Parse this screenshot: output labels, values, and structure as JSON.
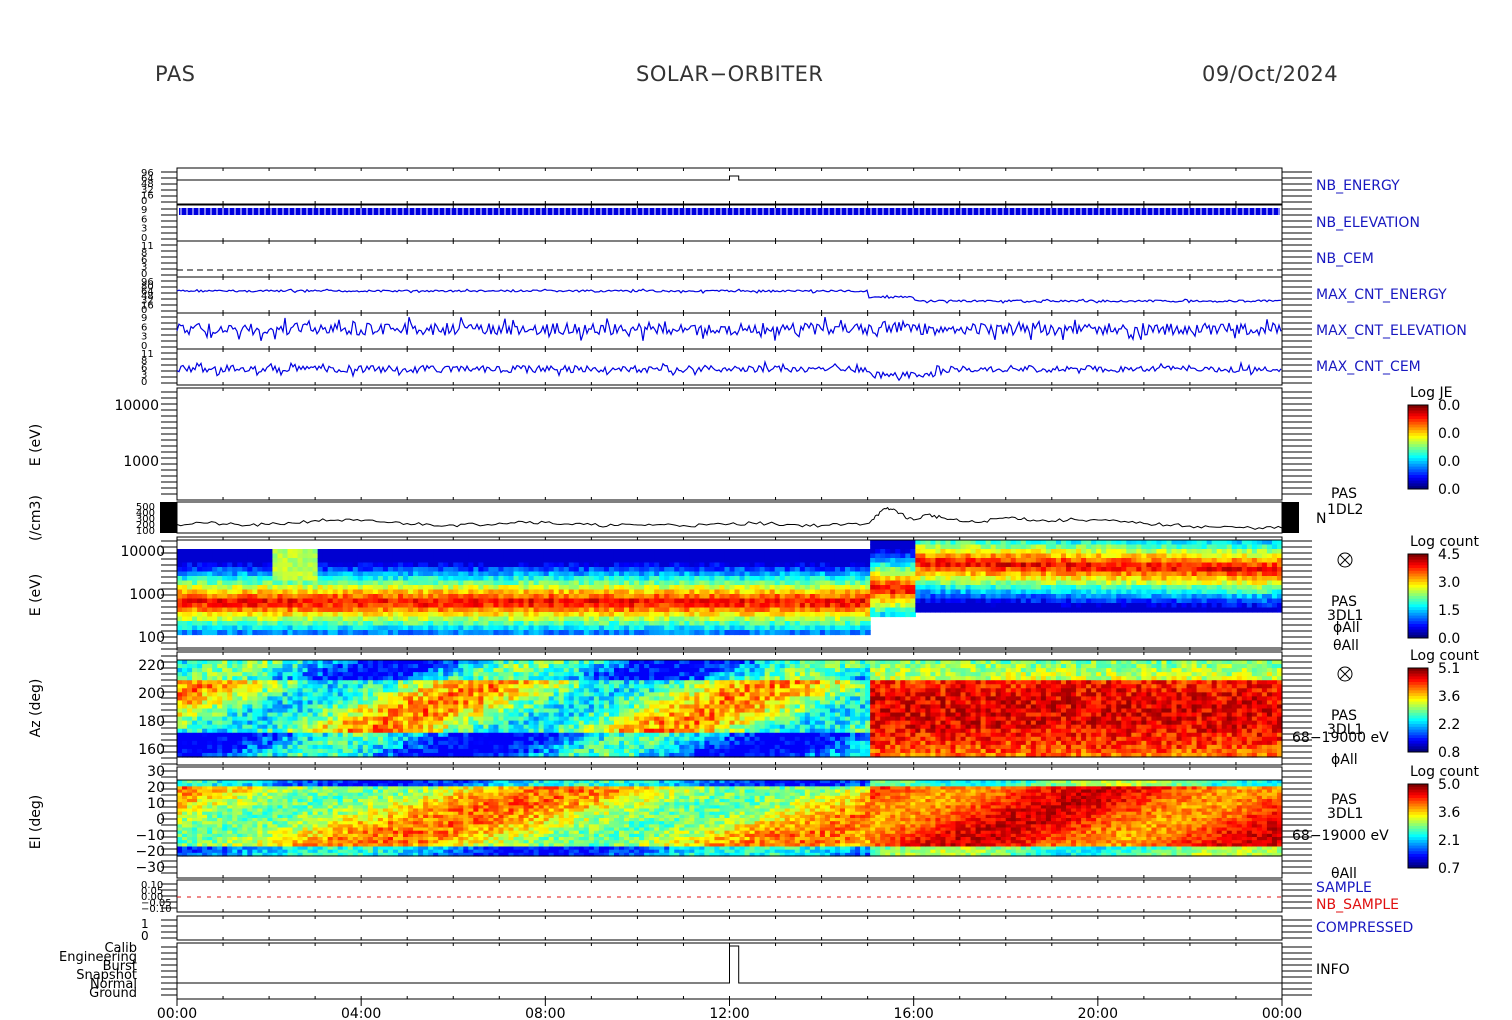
{
  "header": {
    "instrument": "PAS",
    "mission": "SOLAR−ORBITER",
    "date": "09/Oct/2024"
  },
  "colors": {
    "trace_blue": "#0000e0",
    "label_blue": "#1818c0",
    "label_red": "#e01010",
    "axis": "#000000"
  },
  "chart_data": [
    {
      "type": "line",
      "panels": [
        {
          "label": "NB_ENERGY",
          "yticks": [
            "96",
            "64",
            "48",
            "32",
            "16",
            "0"
          ]
        },
        {
          "label": "NB_ELEVATION",
          "yticks": [
            "9",
            "6",
            "3",
            "0"
          ]
        },
        {
          "label": "NB_CEM",
          "yticks": [
            "11",
            "8",
            "6",
            "3",
            "0"
          ]
        },
        {
          "label": "MAX_CNT_ENERGY",
          "yticks": [
            "96",
            "80",
            "64",
            "48",
            "32",
            "16",
            "0"
          ]
        },
        {
          "label": "MAX_CNT_ELEVATION",
          "yticks": [
            "9",
            "6",
            "3",
            "0"
          ]
        },
        {
          "label": "MAX_CNT_CEM",
          "yticks": [
            "11",
            "8",
            "6",
            "3",
            "0"
          ]
        }
      ]
    },
    {
      "type": "heatmap",
      "ylabel": "E (eV)",
      "yticks": [
        "10000",
        "1000"
      ],
      "colorbar": {
        "title": "Log JE",
        "ticks": [
          "0.0",
          "0.0",
          "0.0",
          "0.0"
        ]
      }
    },
    {
      "type": "line",
      "ylabel": "(/cm3)",
      "yticks": [
        "500",
        "400",
        "300",
        "200",
        "100"
      ],
      "side_labels": [
        "PAS",
        "1DL2",
        "N"
      ],
      "points": [
        [
          0,
          0.22
        ],
        [
          0.5,
          0.3
        ],
        [
          1,
          0.24
        ],
        [
          1.5,
          0.18
        ],
        [
          2,
          0.22
        ],
        [
          2.5,
          0.28
        ],
        [
          3,
          0.38
        ],
        [
          3.5,
          0.4
        ],
        [
          4,
          0.36
        ],
        [
          4.5,
          0.32
        ],
        [
          5,
          0.26
        ],
        [
          5.5,
          0.22
        ],
        [
          6,
          0.2
        ],
        [
          6.5,
          0.22
        ],
        [
          7,
          0.28
        ],
        [
          7.5,
          0.34
        ],
        [
          8,
          0.3
        ],
        [
          8.5,
          0.24
        ],
        [
          9,
          0.2
        ],
        [
          9.5,
          0.18
        ],
        [
          10,
          0.2
        ],
        [
          10.5,
          0.22
        ],
        [
          11,
          0.18
        ],
        [
          11.5,
          0.2
        ],
        [
          12,
          0.24
        ],
        [
          12.5,
          0.28
        ],
        [
          13,
          0.24
        ],
        [
          13.5,
          0.2
        ],
        [
          14,
          0.18
        ],
        [
          14.5,
          0.22
        ],
        [
          15,
          0.26
        ],
        [
          15.2,
          0.6
        ],
        [
          15.4,
          0.85
        ],
        [
          15.6,
          0.8
        ],
        [
          15.8,
          0.55
        ],
        [
          16,
          0.4
        ],
        [
          16.3,
          0.62
        ],
        [
          16.6,
          0.5
        ],
        [
          17,
          0.35
        ],
        [
          17.4,
          0.3
        ],
        [
          17.8,
          0.45
        ],
        [
          18.2,
          0.5
        ],
        [
          18.6,
          0.4
        ],
        [
          19,
          0.36
        ],
        [
          19.5,
          0.42
        ],
        [
          20,
          0.4
        ],
        [
          20.5,
          0.32
        ],
        [
          21,
          0.26
        ],
        [
          21.5,
          0.2
        ],
        [
          22,
          0.16
        ],
        [
          22.5,
          0.12
        ],
        [
          23,
          0.1
        ],
        [
          23.5,
          0.09
        ],
        [
          24,
          0.08
        ]
      ]
    },
    {
      "type": "heatmap",
      "ylabel": "E (eV)",
      "yticks": [
        "10000",
        "1000",
        "100"
      ],
      "side_labels": [
        "PAS",
        "3DL1",
        "ϕAll",
        "θAll"
      ],
      "colorbar": {
        "title": "Log count",
        "ticks": [
          "4.5",
          "3.0",
          "1.5",
          "0.0"
        ]
      }
    },
    {
      "type": "heatmap",
      "ylabel": "Az (deg)",
      "yticks": [
        "220",
        "200",
        "180",
        "160"
      ],
      "side_labels": [
        "PAS",
        "3DL1",
        "68−19000 eV",
        "ϕAll"
      ],
      "colorbar": {
        "title": "Log count",
        "ticks": [
          "5.1",
          "3.6",
          "2.2",
          "0.8"
        ]
      }
    },
    {
      "type": "heatmap",
      "ylabel": "El (deg)",
      "yticks": [
        "30",
        "20",
        "10",
        "0",
        "−10",
        "−20",
        "−30"
      ],
      "side_labels": [
        "PAS",
        "3DL1",
        "68−19000 eV",
        "θAll"
      ],
      "colorbar": {
        "title": "Log count",
        "ticks": [
          "5.0",
          "3.6",
          "2.1",
          "0.7"
        ]
      }
    },
    {
      "type": "line",
      "panels": [
        {
          "label": "SAMPLE",
          "yticks": [
            "0.10",
            "0.05",
            "0.00",
            "−0.05",
            "−0.10"
          ]
        },
        {
          "label": "NB_SAMPLE"
        },
        {
          "label": "COMPRESSED",
          "yticks": [
            "1",
            "0"
          ]
        },
        {
          "label": "INFO",
          "yticks": [
            "Calib",
            "Engineering",
            "Burst",
            "Snapshot",
            "Normal",
            "Ground"
          ]
        }
      ]
    }
  ],
  "xaxis": {
    "ticks": [
      "00:00",
      "04:00",
      "08:00",
      "12:00",
      "16:00",
      "20:00",
      "00:00"
    ]
  }
}
